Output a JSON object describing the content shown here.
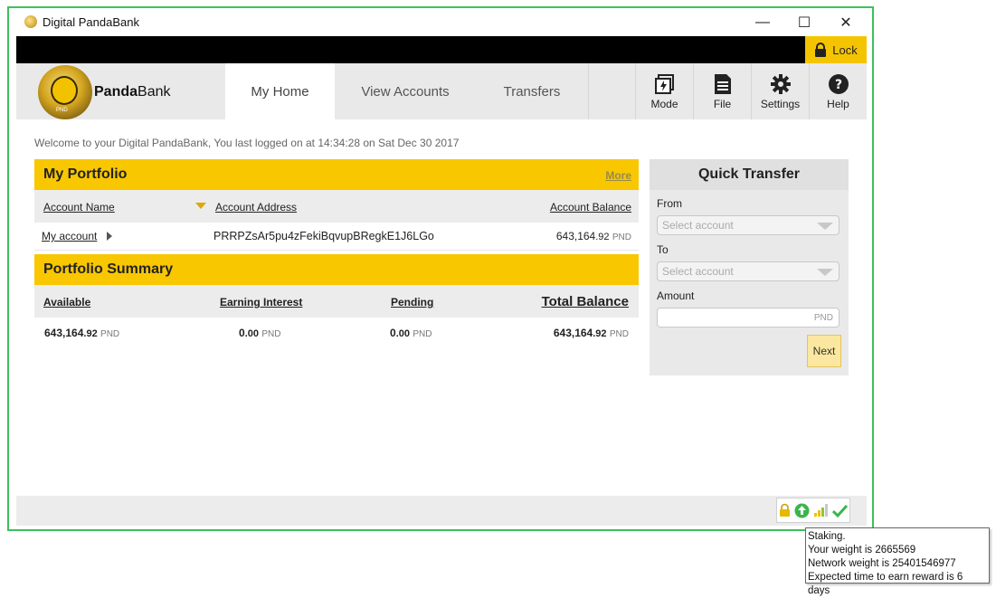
{
  "window": {
    "title": "Digital PandaBank",
    "minimize": "—",
    "maximize": "☐",
    "close": "✕"
  },
  "topbar": {
    "lock_label": "Lock"
  },
  "nav": {
    "logo_text_bold": "Panda",
    "logo_text_rest": "Bank",
    "logo_badge": "PND",
    "tabs": [
      {
        "label": "My Home",
        "active": true
      },
      {
        "label": "View Accounts",
        "active": false
      },
      {
        "label": "Transfers",
        "active": false
      }
    ],
    "tools": [
      {
        "label": "Mode",
        "icon": "mode-icon"
      },
      {
        "label": "File",
        "icon": "file-icon"
      },
      {
        "label": "Settings",
        "icon": "gear-icon"
      },
      {
        "label": "Help",
        "icon": "help-icon"
      }
    ]
  },
  "welcome": "Welcome to your Digital PandaBank, You last logged on at 14:34:28 on Sat Dec 30 2017",
  "portfolio": {
    "title": "My Portfolio",
    "more": "More",
    "columns": {
      "name": "Account Name",
      "address": "Account Address",
      "balance": "Account Balance"
    },
    "rows": [
      {
        "name": "My account",
        "address": "PRRPZsAr5pu4zFekiBqvupBRegkE1J6LGo",
        "balance_int": "643,164",
        "balance_dec": ".92",
        "unit": "PND"
      }
    ]
  },
  "summary": {
    "title": "Portfolio Summary",
    "headers": {
      "available": "Available",
      "earning": "Earning Interest",
      "pending": "Pending",
      "total": "Total Balance"
    },
    "values": {
      "available_int": "643,164",
      "available_dec": ".92",
      "earning_int": "0",
      "earning_dec": ".00",
      "pending_int": "0",
      "pending_dec": ".00",
      "total_int": "643,164",
      "total_dec": ".92",
      "unit": "PND"
    }
  },
  "quick_transfer": {
    "title": "Quick Transfer",
    "from_label": "From",
    "from_placeholder": "Select account",
    "to_label": "To",
    "to_placeholder": "Select account",
    "amount_label": "Amount",
    "amount_unit": "PND",
    "next": "Next"
  },
  "tooltip": {
    "line1": "Staking.",
    "line2": "Your weight is 2665569",
    "line3": "Network weight is 25401546977",
    "line4": "Expected time to earn reward is 6 days"
  },
  "colors": {
    "accent": "#f8c700",
    "frame": "#3fbf5a"
  }
}
